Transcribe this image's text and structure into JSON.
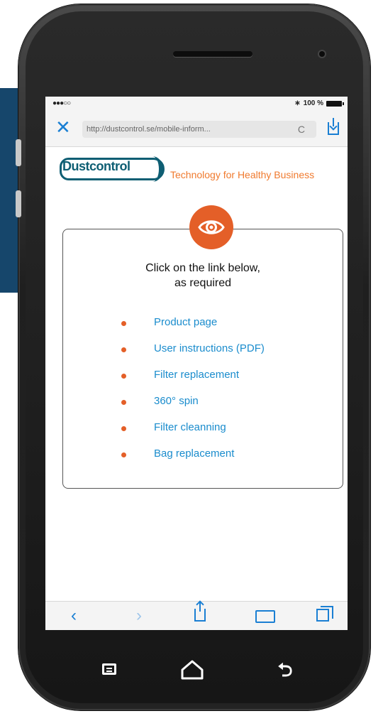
{
  "statusbar": {
    "signal": "●●●○○",
    "battery_text": "100 %"
  },
  "browser": {
    "close_icon": "✕",
    "url": "http://dustcontrol.se/mobile-inform...",
    "reload_icon": "C"
  },
  "site": {
    "logo_text": "Dustcontrol",
    "tagline": "Technology for Healthy Business"
  },
  "card": {
    "heading_line1": "Click on the link below,",
    "heading_line2": "as required",
    "links": [
      {
        "label": "Product page"
      },
      {
        "label": "User instructions (PDF)"
      },
      {
        "label": "Filter replacement"
      },
      {
        "label": "360° spin"
      },
      {
        "label": "Filter cleanning"
      },
      {
        "label": "Bag replacement"
      }
    ]
  },
  "toolbar": {
    "back_icon": "‹",
    "forward_icon": "›"
  },
  "colors": {
    "accent_orange": "#e45f28",
    "link_blue": "#1a8ccd",
    "ios_blue": "#1a7fd3",
    "brand_teal": "#0e5e73",
    "side_panel": "#16466b"
  },
  "nav": {
    "back_glyph": "⮌"
  }
}
